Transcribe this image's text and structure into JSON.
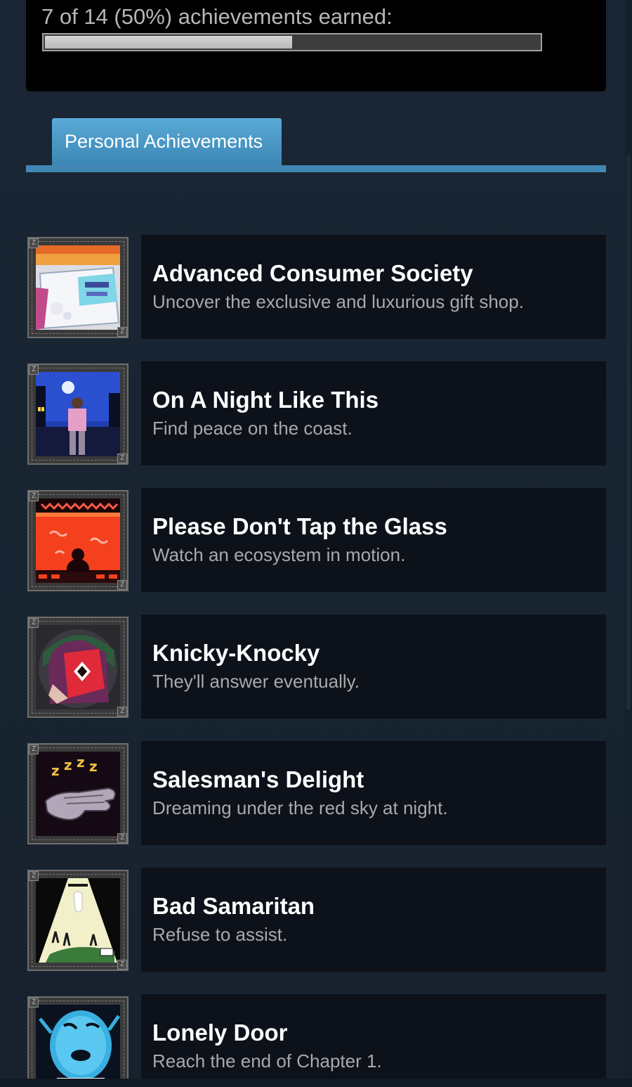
{
  "summary": {
    "text": "7 of 14 (50%) achievements earned:",
    "progress_fraction": 0.5
  },
  "tabs": {
    "active_label": "Personal Achievements"
  },
  "achievements": [
    {
      "title": "Advanced Consumer Society",
      "description": "Uncover the exclusive and luxurious gift shop.",
      "icon": "gift-shop-icon"
    },
    {
      "title": "On A Night Like This",
      "description": "Find peace on the coast.",
      "icon": "night-coast-icon"
    },
    {
      "title": "Please Don't Tap the Glass",
      "description": "Watch an ecosystem in motion.",
      "icon": "aquarium-icon"
    },
    {
      "title": "Knicky-Knocky",
      "description": "They'll answer eventually.",
      "icon": "masked-figure-icon"
    },
    {
      "title": "Salesman's Delight",
      "description": "Dreaming under the red sky at night.",
      "icon": "sleeping-hand-icon"
    },
    {
      "title": "Bad Samaritan",
      "description": "Refuse to assist.",
      "icon": "spotlight-ghost-icon"
    },
    {
      "title": "Lonely Door",
      "description": "Reach the end of Chapter 1.",
      "icon": "blue-face-icon"
    }
  ],
  "colors": {
    "background": "#1b2838",
    "tab_accent": "#4287b3",
    "card_background": "#0c111a"
  }
}
